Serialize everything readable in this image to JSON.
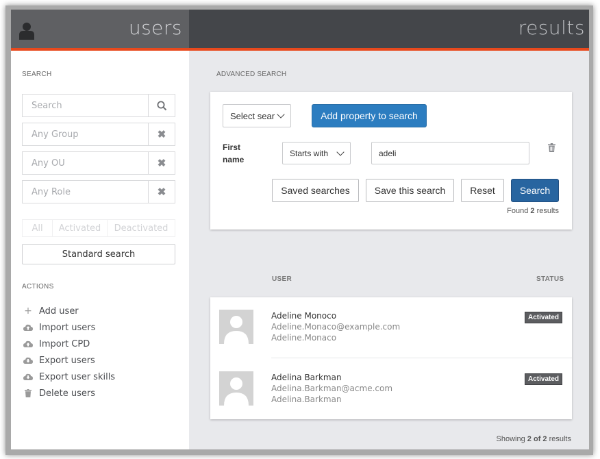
{
  "header": {
    "left_title": "users",
    "right_title": "results"
  },
  "sidebar": {
    "search_section_label": "SEARCH",
    "search_placeholder": "Search",
    "group_filter": "Any Group",
    "ou_filter": "Any OU",
    "role_filter": "Any Role",
    "status_tabs": [
      "All",
      "Activated",
      "Deactivated"
    ],
    "standard_search_label": "Standard search",
    "actions_section_label": "ACTIONS",
    "actions": [
      {
        "label": "Add user",
        "icon": "plus-icon"
      },
      {
        "label": "Import users",
        "icon": "cloud-upload-icon"
      },
      {
        "label": "Import CPD",
        "icon": "cloud-upload-icon"
      },
      {
        "label": "Export users",
        "icon": "cloud-download-icon"
      },
      {
        "label": "Export user skills",
        "icon": "cloud-download-icon"
      },
      {
        "label": "Delete users",
        "icon": "trash-icon"
      }
    ]
  },
  "advanced": {
    "section_label": "ADVANCED SEARCH",
    "select_placeholder": "Select sear",
    "add_property_label": "Add property to search",
    "criterion": {
      "field_line1": "First",
      "field_line2": "name",
      "operator": "Starts with",
      "value": "adeli"
    },
    "saved_searches_label": "Saved searches",
    "save_search_label": "Save this search",
    "reset_label": "Reset",
    "search_label": "Search",
    "found_prefix": "Found",
    "found_count": "2",
    "found_suffix": "results"
  },
  "results": {
    "col_user": "USER",
    "col_status": "STATUS",
    "rows": [
      {
        "name": "Adeline Monoco",
        "email": "Adeline.Monaco@example.com",
        "username": "Adeline.Monaco",
        "status": "Activated"
      },
      {
        "name": "Adelina Barkman",
        "email": "Adelina.Barkman@acme.com",
        "username": "Adelina.Barkman",
        "status": "Activated"
      }
    ],
    "footer_prefix": "Showing",
    "footer_count": "2 of 2",
    "footer_suffix": "results"
  },
  "colors": {
    "accent": "#e8491d",
    "primary_button": "#2c7dc0",
    "header_dark": "#44464a",
    "header_mid": "#5f6063",
    "badge": "#5c5d60"
  }
}
